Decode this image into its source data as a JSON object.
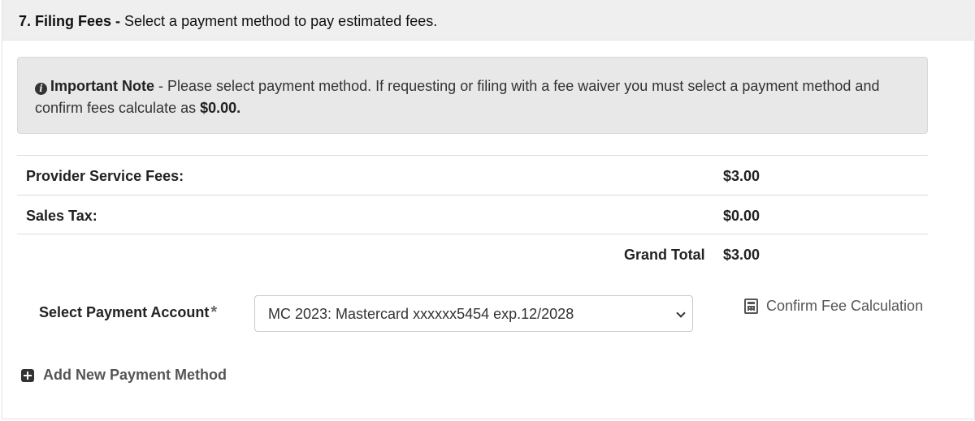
{
  "header": {
    "number_title": "7. Filing Fees -",
    "subtitle": " Select a payment method to pay estimated fees."
  },
  "note": {
    "icon": "info-circle-icon",
    "title": "Important Note",
    "text_before": " - Please select payment method. If requesting or filing with a fee waiver you must select a payment method and confirm fees calculate as ",
    "amount": "$0.00."
  },
  "fees": [
    {
      "label": "Provider Service Fees:",
      "amount": "$3.00"
    },
    {
      "label": "Sales Tax:",
      "amount": "$0.00"
    }
  ],
  "grand_total": {
    "label": "Grand Total",
    "amount": "$3.00"
  },
  "payment": {
    "label": "Select Payment Account",
    "required_marker": "*",
    "selected": "MC 2023: Mastercard xxxxxx5454 exp.12/2028"
  },
  "confirm": {
    "icon": "calculator-icon",
    "label": "Confirm Fee Calculation"
  },
  "add_method": {
    "icon": "plus-square-icon",
    "label": "Add New Payment Method"
  },
  "colors": {
    "header_bg": "#efefef",
    "note_bg": "#e8e8e8",
    "text": "#222222",
    "muted": "#555555"
  }
}
